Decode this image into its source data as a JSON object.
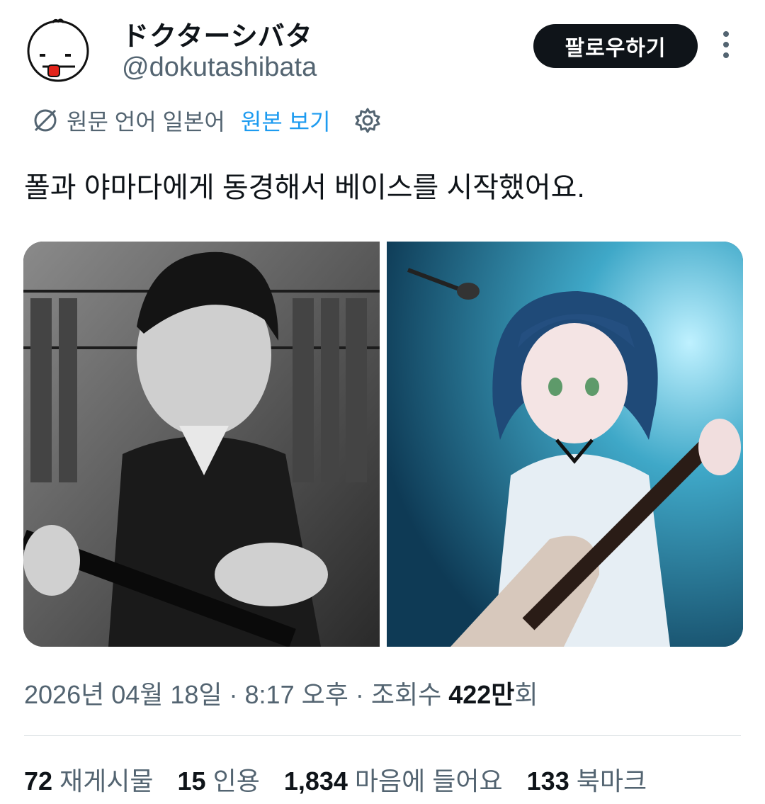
{
  "author": {
    "display_name": "ドクターシバタ",
    "handle": "@dokutashibata"
  },
  "actions": {
    "follow_label": "팔로우하기",
    "more_icon": "more-vertical-icon"
  },
  "translation": {
    "icon": "globe-slash-icon",
    "source_language": "원문 언어 일본어",
    "show_original": "원본 보기",
    "settings_icon": "gear-icon"
  },
  "tweet": {
    "text": "폴과 야마다에게 동경해서 베이스를 시작했어요."
  },
  "media": {
    "images": [
      {
        "description": "black-and-white photo of a man playing a bass guitar in front of bookshelves"
      },
      {
        "description": "anime girl with short blue hair playing a bass guitar on a stage with a microphone"
      }
    ]
  },
  "meta": {
    "timestamp": "2026년 04월 18일 · 8:17 오후 · 조회수 ",
    "views_number": "422만",
    "views_suffix": "회"
  },
  "stats": [
    {
      "count": "72",
      "label": "재게시물"
    },
    {
      "count": "15",
      "label": "인용"
    },
    {
      "count": "1,834",
      "label": "마음에 들어요"
    },
    {
      "count": "133",
      "label": "북마크"
    }
  ],
  "colors": {
    "text_primary": "#0f1419",
    "text_secondary": "#536471",
    "accent_blue": "#1d9bf0",
    "button_bg": "#0f1419"
  }
}
